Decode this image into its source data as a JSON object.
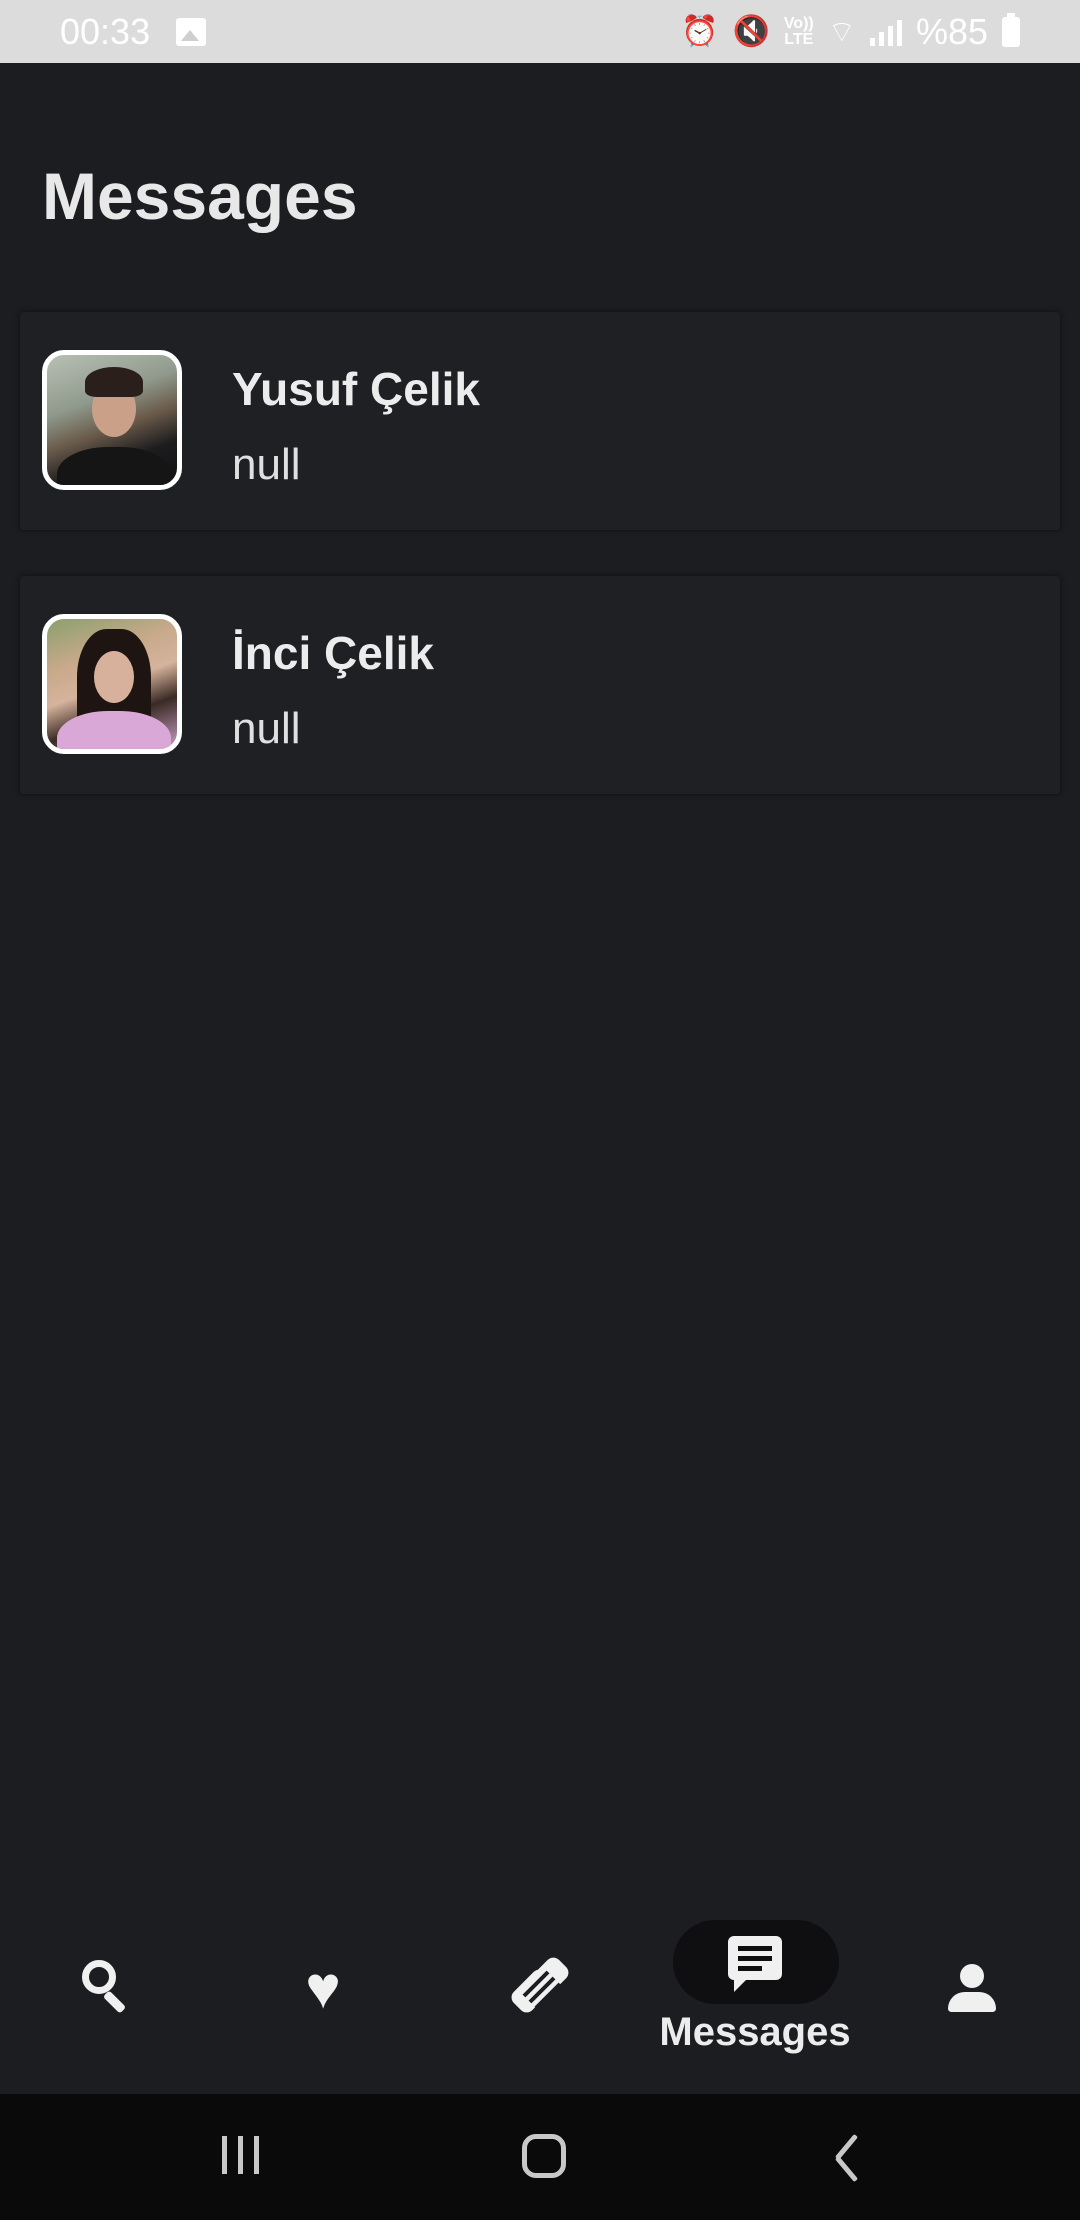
{
  "status_bar": {
    "time": "00:33",
    "lte_top": "Vo))",
    "lte_bottom": "LTE",
    "battery_text": "%85",
    "icons": [
      "image-icon",
      "alarm-icon",
      "mute-icon",
      "volte-icon",
      "wifi-icon",
      "signal-icon",
      "battery-icon"
    ]
  },
  "page": {
    "title": "Messages"
  },
  "conversations": [
    {
      "name": "Yusuf Çelik",
      "preview": "null",
      "avatar": "avatar-photo"
    },
    {
      "name": "İnci Çelik",
      "preview": "null",
      "avatar": "avatar-photo"
    }
  ],
  "bottom_nav": {
    "items": [
      {
        "id": "search",
        "icon": "search-icon",
        "label": ""
      },
      {
        "id": "favorites",
        "icon": "heart-icon",
        "label": ""
      },
      {
        "id": "matches",
        "icon": "handshake-icon",
        "label": ""
      },
      {
        "id": "messages",
        "icon": "message-icon",
        "label": "Messages",
        "active": true
      },
      {
        "id": "profile",
        "icon": "person-icon",
        "label": ""
      }
    ]
  },
  "system_nav": {
    "icons": [
      "recents-icon",
      "home-icon",
      "back-icon"
    ]
  },
  "colors": {
    "background": "#1c1d21",
    "card": "#1f2024",
    "status_bar": "#dcdcdc",
    "active_pill": "#0f0f11",
    "text": "#ececec"
  }
}
